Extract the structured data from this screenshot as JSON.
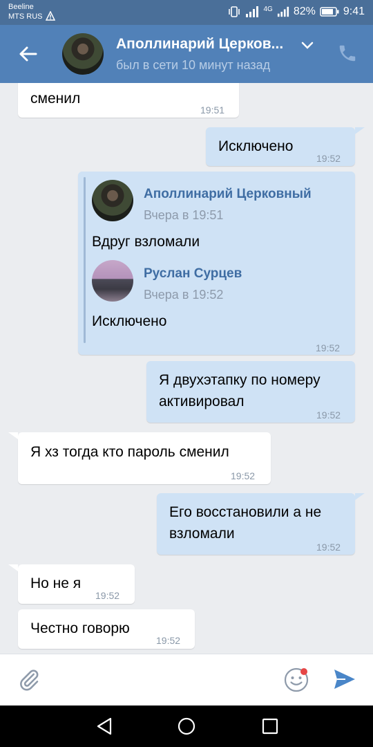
{
  "status_bar": {
    "carrier_1": "Beeline",
    "carrier_2": "MTS RUS",
    "network": "4G",
    "battery": "82%",
    "time": "9:41"
  },
  "header": {
    "name": "Аполлинарий Церков...",
    "status": "был в сети 10 минут назад"
  },
  "messages": [
    {
      "dir": "in",
      "text": "сменил",
      "time": "19:51"
    },
    {
      "dir": "out",
      "text": "Исключено",
      "time": "19:52"
    },
    {
      "dir": "out",
      "type": "forward",
      "time": "19:52",
      "forwarded": [
        {
          "author": "Аполлинарий Церковный",
          "date": "Вчера в 19:51",
          "text": "Вдруг взломали"
        },
        {
          "author": "Руслан Сурцев",
          "date": "Вчера в 19:52",
          "text": "Исключено"
        }
      ]
    },
    {
      "dir": "out",
      "text_lines": [
        "Я двухэтапку по номеру",
        "активировал"
      ],
      "time": "19:52"
    },
    {
      "dir": "in",
      "text": "Я хз тогда кто пароль сменил",
      "time": "19:52"
    },
    {
      "dir": "out",
      "text_lines": [
        "Его восстановили а не",
        "взломали"
      ],
      "time": "19:52"
    },
    {
      "dir": "in",
      "text": "Но не я",
      "time": "19:52"
    },
    {
      "dir": "in",
      "text": "Честно говорю",
      "time": "19:52"
    }
  ],
  "icons": {
    "back": "arrow-left-icon",
    "chevron": "chevron-down-icon",
    "call": "phone-icon",
    "attach": "paperclip-icon",
    "emoji": "smiley-icon",
    "send": "send-icon"
  },
  "colors": {
    "header_bg": "#5181b8",
    "status_bar_bg": "#4a6f99",
    "chat_bg": "#ebedf0",
    "outgoing_bubble": "#cfe2f5",
    "incoming_bubble": "#ffffff",
    "link_name": "#3f6da3",
    "send_accent": "#4a86c8"
  }
}
